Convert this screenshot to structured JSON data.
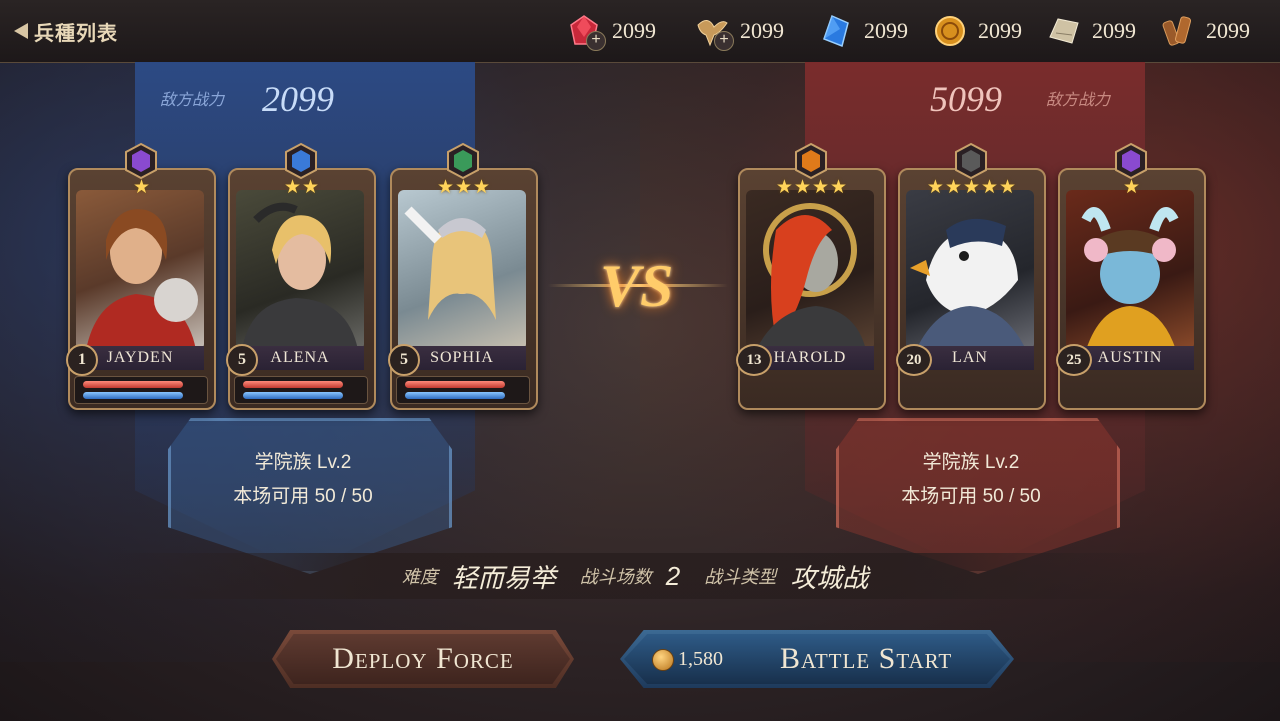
{
  "header": {
    "back_title": "兵種列表"
  },
  "resources": [
    {
      "icon": "ruby-gem-icon",
      "value": "2099",
      "has_plus": true
    },
    {
      "icon": "eagle-wing-icon",
      "value": "2099",
      "has_plus": true
    },
    {
      "icon": "blue-crystal-icon",
      "value": "2099",
      "has_plus": false
    },
    {
      "icon": "gold-coin-icon",
      "value": "2099",
      "has_plus": false
    },
    {
      "icon": "stone-slab-icon",
      "value": "2099",
      "has_plus": false
    },
    {
      "icon": "wood-log-icon",
      "value": "2099",
      "has_plus": false
    }
  ],
  "left_team": {
    "power_label": "敌方战力",
    "power_value": "2099",
    "faction": "学院族 Lv.2",
    "usage": "本场可用 50 / 50",
    "heroes": [
      {
        "name": "JAYDEN",
        "level": "1",
        "stars": "★",
        "gem_color": "#8a4ad0"
      },
      {
        "name": "ALENA",
        "level": "5",
        "stars": "★★",
        "gem_color": "#3a7ad8"
      },
      {
        "name": "SOPHIA",
        "level": "5",
        "stars": "★★★",
        "gem_color": "#3a9a5a"
      }
    ]
  },
  "right_team": {
    "power_label": "敌方战力",
    "power_value": "5099",
    "faction": "学院族 Lv.2",
    "usage": "本场可用 50 / 50",
    "heroes": [
      {
        "name": "HAROLD",
        "level": "13",
        "stars": "★★★★",
        "gem_color": "#e07a1a"
      },
      {
        "name": "LAN",
        "level": "20",
        "stars": "★★★★★",
        "gem_color": "#5a5a5a"
      },
      {
        "name": "AUSTIN",
        "level": "25",
        "stars": "★",
        "gem_color": "#8a4ad0"
      }
    ]
  },
  "vs_text": "VS",
  "battle_info": {
    "difficulty_label": "难度",
    "difficulty_value": "轻而易举",
    "rounds_label": "战斗场数",
    "rounds_value": "2",
    "type_label": "战斗类型",
    "type_value": "攻城战"
  },
  "buttons": {
    "deploy_label": "Deploy Force",
    "battle_label": "Battle Start",
    "battle_cost": "1,580"
  },
  "colors": {
    "left_accent": "#2c4a84",
    "right_accent": "#7a2c2c",
    "left_power_text": "#9ab8e8",
    "right_power_text": "#e8a8a0",
    "vs_gold": "#ffcc6a"
  }
}
